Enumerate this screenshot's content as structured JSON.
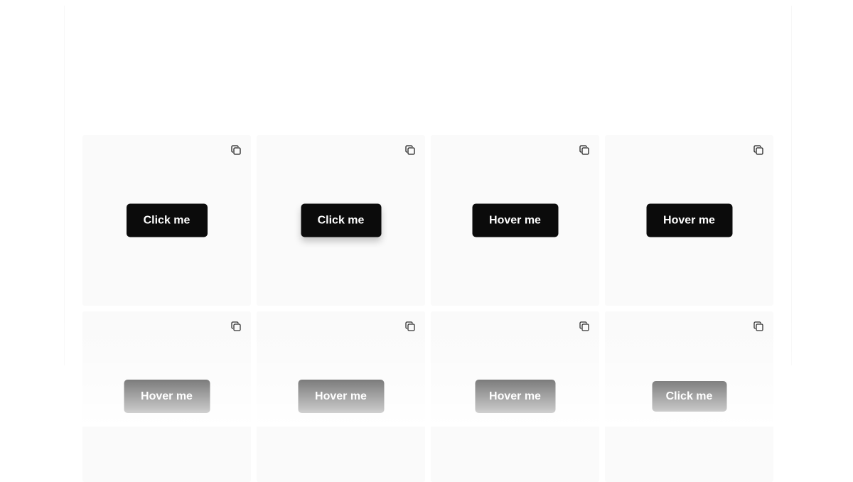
{
  "cards": [
    {
      "button_label": "Click me",
      "copy_icon": "copy-icon"
    },
    {
      "button_label": "Click me",
      "copy_icon": "copy-icon"
    },
    {
      "button_label": "Hover me",
      "copy_icon": "copy-icon"
    },
    {
      "button_label": "Hover me",
      "copy_icon": "copy-icon"
    },
    {
      "button_label": "Hover me",
      "copy_icon": "copy-icon"
    },
    {
      "button_label": "Hover me",
      "copy_icon": "copy-icon"
    },
    {
      "button_label": "Hover me",
      "copy_icon": "copy-icon"
    },
    {
      "button_label": "Click me",
      "copy_icon": "copy-icon"
    }
  ],
  "colors": {
    "card_background": "#fafafa",
    "button_background": "#0b0b0b",
    "button_text": "#ffffff"
  }
}
